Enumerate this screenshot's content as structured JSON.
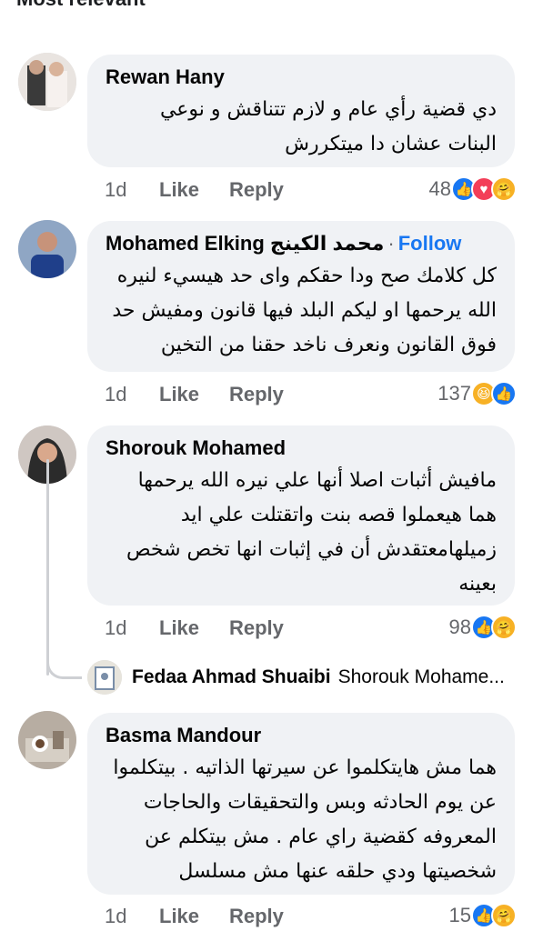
{
  "header": {
    "title": "Most relevant"
  },
  "comments": [
    {
      "author": "Rewan Hany",
      "text_lines": [
        "دي قضية رأي عام و لازم تتناقش و نوعي",
        "البنات عشان دا ميتكررش"
      ],
      "time": "1d",
      "like": "Like",
      "reply": "Reply",
      "reactions_count": "48"
    },
    {
      "author": "Mohamed Elking محمد الكينج",
      "follow": "Follow",
      "follow_dot": "·",
      "text_lines": [
        "كل كلامك صح ودا حقكم واى حد هيسيء لنيره",
        "الله يرحمها او ليكم البلد فيها قانون ومفيش حد",
        "فوق القانون  ونعرف ناخد حقنا من التخين"
      ],
      "time": "1d",
      "like": "Like",
      "reply": "Reply",
      "reactions_count": "137"
    },
    {
      "author": "Shorouk Mohamed",
      "text_lines": [
        "مافيش أثبات اصلا أنها علي نيره الله يرحمها",
        "هما هيعملوا قصه بنت واتقتلت علي ايد",
        "زميلهامعتقدش أن في إثبات انها تخص شخص",
        "بعينه"
      ],
      "time": "1d",
      "like": "Like",
      "reply": "Reply",
      "reactions_count": "98"
    },
    {
      "author": "Basma Mandour",
      "text_lines": [
        "هما مش هايتكلموا عن سيرتها الذاتيه . بيتكلموا",
        "عن يوم الحادثه وبس والتحقيقات والحاجات",
        "المعروفه كقضية راي عام . مش بيتكلم عن",
        "شخصيتها ودي حلقه عنها مش مسلسل"
      ],
      "time": "1d",
      "like": "Like",
      "reply": "Reply",
      "reactions_count": "15"
    }
  ],
  "reply_preview": {
    "author": "Fedaa Ahmad Shuaibi",
    "text": "Shorouk Mohame..."
  },
  "colors": {
    "bubble": "#f0f2f5",
    "meta": "#65676b",
    "link": "#1877f2",
    "like_icon": "#1877f2",
    "love_icon": "#f33e58",
    "care_icon": "#f7b125"
  },
  "icons": [
    "like-reaction-icon",
    "love-reaction-icon",
    "care-reaction-icon",
    "haha-reaction-icon"
  ]
}
